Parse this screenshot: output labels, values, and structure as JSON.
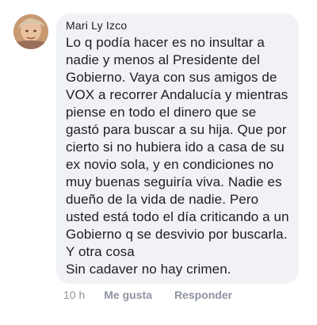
{
  "comment": {
    "author": "Mari Ly Izco",
    "text": "Lo q podía hacer es no insultar a\nnadie y menos al Presidente del\nGobierno. Vaya con sus amigos de\nVOX a recorrer Andalucía y mientras\npiense en todo el dinero que se\ngastó para buscar a su hija. Que por\ncierto si no hubiera ido a casa de su\nex novio sola, y en condiciones no\nmuy buenas seguiría viva. Nadie es\ndueño de la vida de nadie. Pero\nusted está todo el día criticando a un\nGobierno q se desvivio por buscarla.\nY otra cosa\nSin cadaver no hay crimen.",
    "avatar_icon": "user-avatar-photo"
  },
  "actions": {
    "time": "10 h",
    "like_label": "Me gusta",
    "reply_label": "Responder"
  },
  "colors": {
    "bubble_bg": "#f0f2f5",
    "text": "#1c1e21",
    "muted": "#8d949e"
  }
}
